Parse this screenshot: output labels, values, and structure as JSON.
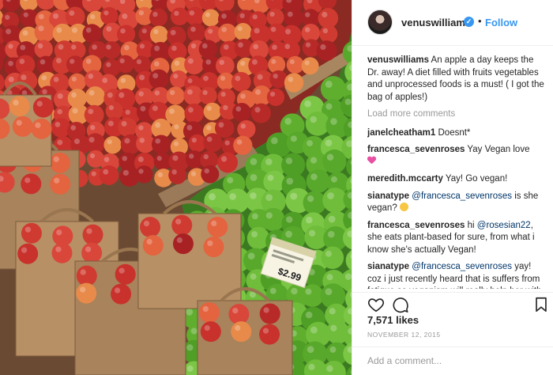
{
  "post": {
    "photo_alt": "",
    "price_tag": "$2.99",
    "author": {
      "username": "venuswilliams",
      "verified_icon": "verified-badge-icon",
      "separator": "•",
      "follow_label": "Follow"
    },
    "caption": {
      "username": "venuswilliams",
      "text": "An apple a day keeps the Dr. away! A diet filled with fruits vegetables and unprocessed foods is a must! ( I got the bag of apples!)"
    },
    "load_more_label": "Load more comments",
    "comments": [
      {
        "username": "janelcheatham1",
        "text": "Doesnt*"
      },
      {
        "username": "francesca_sevenroses",
        "text": "Yay Vegan love",
        "emoji": "pink-heart-icon"
      },
      {
        "username": "meredith.mccarty",
        "text": "Yay! Go vegan!"
      },
      {
        "username": "sianatype",
        "mention": "@francesca_sevenroses",
        "text": "is she vegan?",
        "emoji": "smile-icon"
      },
      {
        "username": "francesca_sevenroses",
        "text_before": "hi",
        "mention": "@rosesian22",
        "text": ", she eats plant-based for sure, from what i know she's actually Vegan!"
      },
      {
        "username": "sianatype",
        "mention": "@francesca_sevenroses",
        "text": "yay! coz i just recently heard that is suffers from fatigue so veganism will really help her with that. hope she wins wimbledon"
      }
    ],
    "actions": {
      "like_icon": "heart-outline-icon",
      "comment_icon": "comment-bubble-icon",
      "save_icon": "bookmark-icon"
    },
    "likes_label": "7,571 likes",
    "date_label": "NOVEMBER 12, 2015",
    "add_comment_placeholder": "Add a comment..."
  }
}
